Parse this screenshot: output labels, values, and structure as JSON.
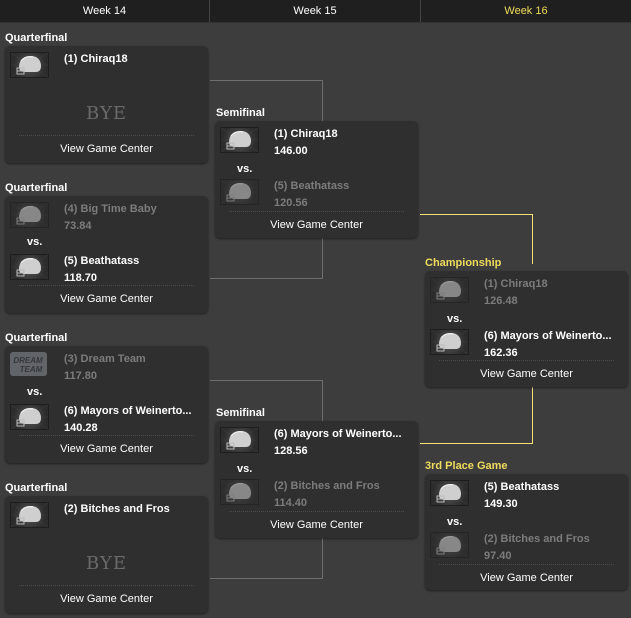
{
  "header": {
    "weeks": [
      "Week 14",
      "Week 15",
      "Week 16"
    ],
    "active_week_color": "#f0dc5c"
  },
  "common": {
    "vs_label": "vs.",
    "bye_label": "BYE",
    "view_game_center": "View Game Center"
  },
  "matchups": {
    "qf1": {
      "round": "Quarterfinal",
      "team1": {
        "name": "(1) Chiraq18",
        "logo": "helmet-icon",
        "winner": true
      },
      "bye": true
    },
    "qf2": {
      "round": "Quarterfinal",
      "team1": {
        "name": "(4) Big Time Baby",
        "score": "73.84",
        "logo": "helmet-icon",
        "winner": false
      },
      "team2": {
        "name": "(5) Beathatass",
        "score": "118.70",
        "logo": "helmet-icon",
        "winner": true
      }
    },
    "qf3": {
      "round": "Quarterfinal",
      "team1": {
        "name": "(3) Dream Team",
        "score": "117.80",
        "logo": "dream-team-logo",
        "winner": false
      },
      "team2": {
        "name": "(6) Mayors of Weinerto...",
        "score": "140.28",
        "logo": "helmet-icon",
        "winner": true
      }
    },
    "qf4": {
      "round": "Quarterfinal",
      "team1": {
        "name": "(2) Bitches and Fros",
        "logo": "helmet-icon",
        "winner": true
      },
      "bye": true
    },
    "sf1": {
      "round": "Semifinal",
      "team1": {
        "name": "(1) Chiraq18",
        "score": "146.00",
        "logo": "helmet-icon",
        "winner": true
      },
      "team2": {
        "name": "(5) Beathatass",
        "score": "120.56",
        "logo": "helmet-icon",
        "winner": false
      }
    },
    "sf2": {
      "round": "Semifinal",
      "team1": {
        "name": "(6) Mayors of Weinerto...",
        "score": "128.56",
        "logo": "helmet-icon",
        "winner": true
      },
      "team2": {
        "name": "(2) Bitches and Fros",
        "score": "114.40",
        "logo": "helmet-icon",
        "winner": false
      }
    },
    "champ": {
      "round": "Championship",
      "team1": {
        "name": "(1) Chiraq18",
        "score": "126.48",
        "logo": "helmet-icon",
        "winner": false
      },
      "team2": {
        "name": "(6) Mayors of Weinerto...",
        "score": "162.36",
        "logo": "helmet-icon",
        "winner": true
      }
    },
    "third": {
      "round": "3rd Place Game",
      "team1": {
        "name": "(5) Beathatass",
        "score": "149.30",
        "logo": "helmet-icon",
        "winner": true
      },
      "team2": {
        "name": "(2) Bitches and Fros",
        "score": "97.40",
        "logo": "helmet-icon",
        "winner": false
      }
    }
  },
  "colors": {
    "background": "#3d3d3d",
    "card": "#2f2f2f",
    "header": "#1f1f1f",
    "gold": "#f0dc5c",
    "loser_text": "#7c7c7c",
    "connector": "#6e6e6e",
    "champ_connector": "#f5e07a"
  }
}
